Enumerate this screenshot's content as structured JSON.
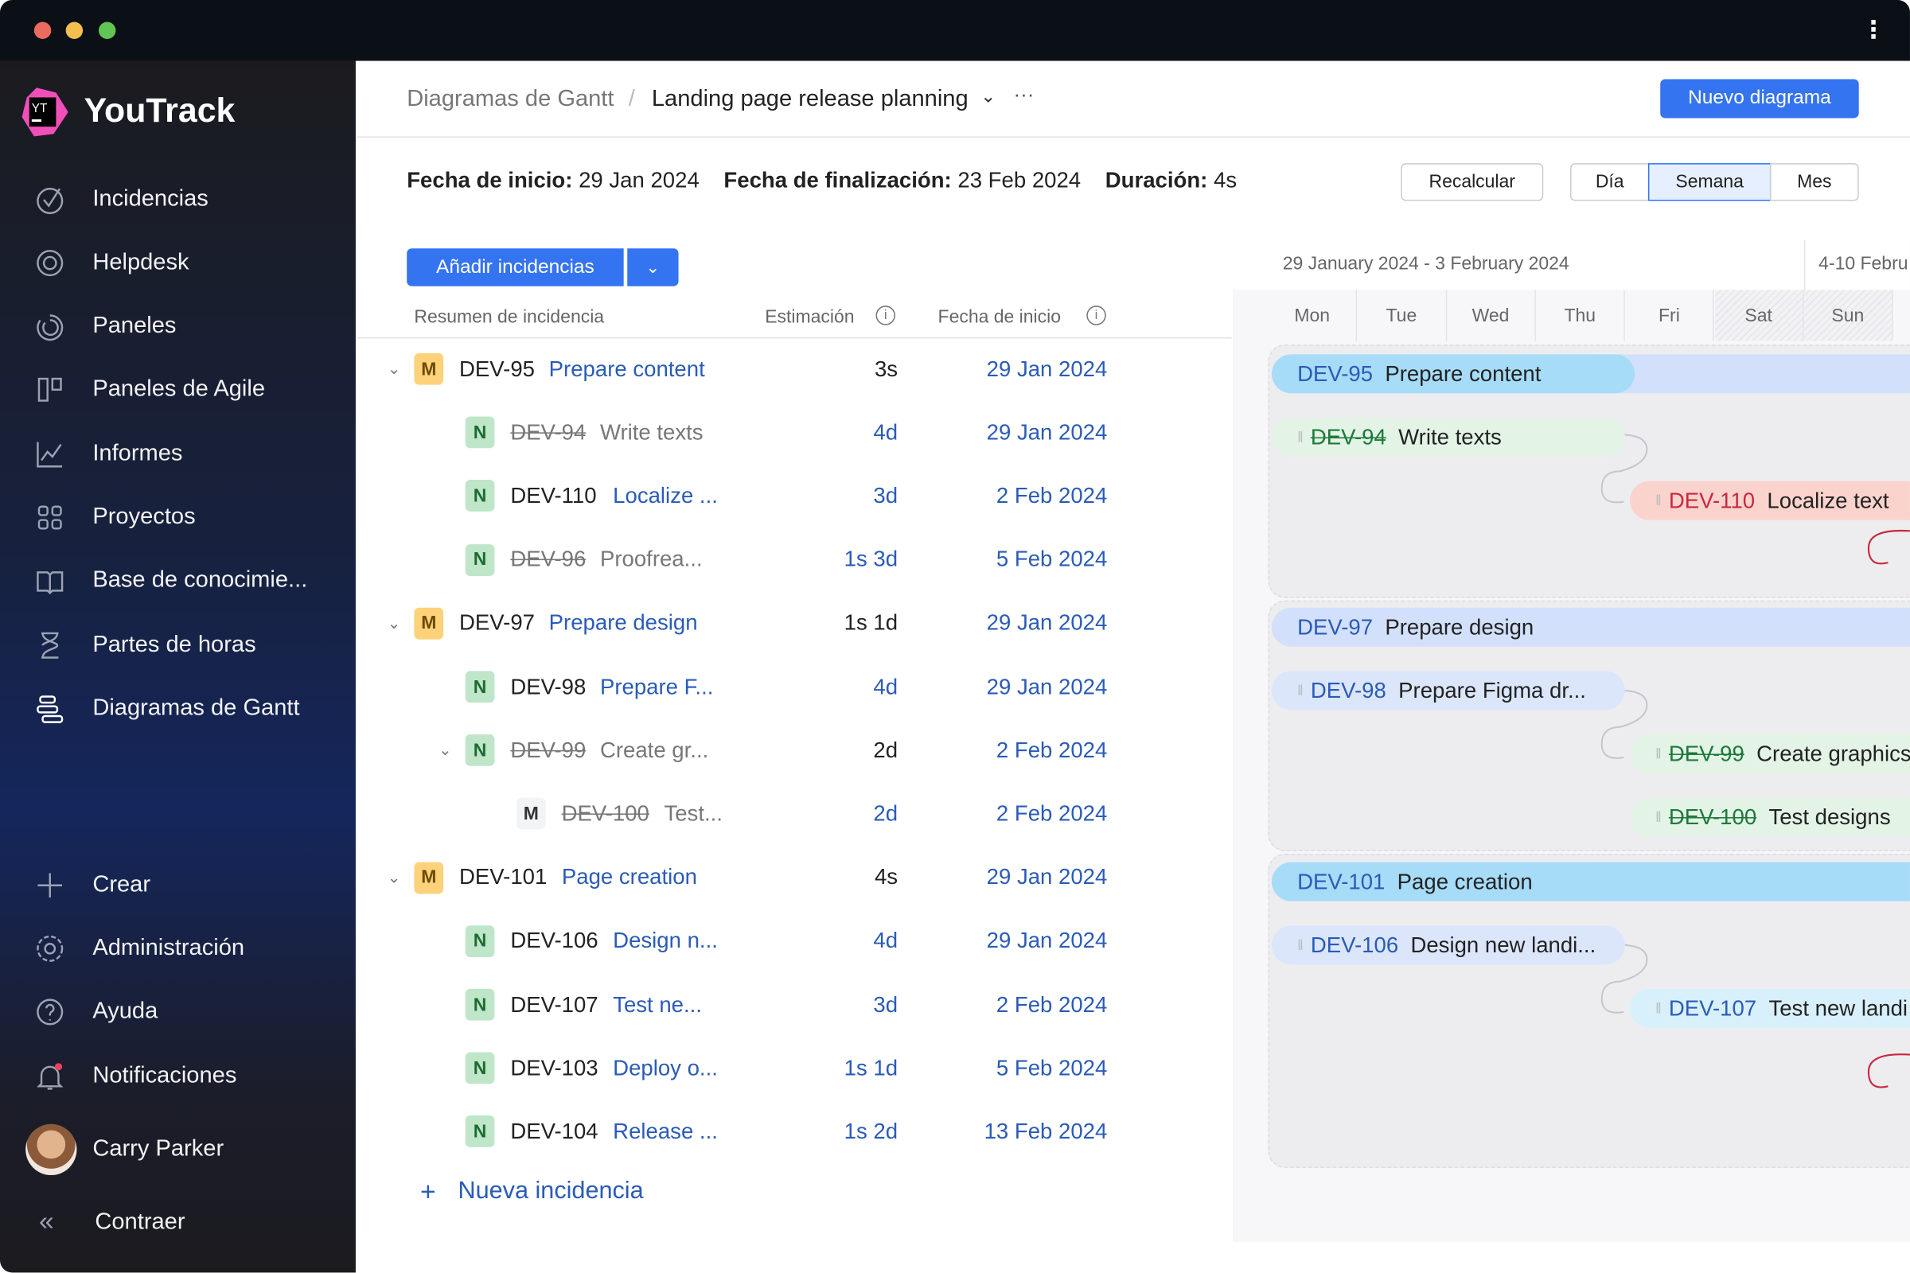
{
  "window": {
    "menu_icon": "vertical-dots-icon"
  },
  "sidebar": {
    "brand": "YouTrack",
    "logo_text": "YT",
    "items": [
      {
        "label": "Incidencias",
        "icon": "check-circle-icon"
      },
      {
        "label": "Helpdesk",
        "icon": "lifebuoy-icon"
      },
      {
        "label": "Paneles",
        "icon": "dashboard-icon"
      },
      {
        "label": "Paneles de Agile",
        "icon": "agile-board-icon"
      },
      {
        "label": "Informes",
        "icon": "chart-icon"
      },
      {
        "label": "Proyectos",
        "icon": "grid-icon"
      },
      {
        "label": "Base de conocimie...",
        "icon": "book-icon"
      },
      {
        "label": "Partes de horas",
        "icon": "hourglass-icon"
      },
      {
        "label": "Diagramas de Gantt",
        "icon": "gantt-icon"
      }
    ],
    "bottom": [
      {
        "label": "Crear",
        "icon": "plus-icon"
      },
      {
        "label": "Administración",
        "icon": "gear-icon"
      },
      {
        "label": "Ayuda",
        "icon": "help-icon"
      },
      {
        "label": "Notificaciones",
        "icon": "bell-icon"
      }
    ],
    "user": "Carry Parker",
    "collapse": "Contraer"
  },
  "header": {
    "breadcrumb_root": "Diagramas de Gantt",
    "separator": "/",
    "title": "Landing page release planning",
    "more": "···",
    "new_button": "Nuevo diagrama"
  },
  "summary": {
    "start_label": "Fecha de inicio:",
    "start": "29 Jan 2024",
    "end_label": "Fecha de finalización:",
    "end": "23 Feb 2024",
    "duration_label": "Duración:",
    "duration": "4s"
  },
  "toolbar": {
    "recalc": "Recalcular",
    "scale": [
      "Día",
      "Semana",
      "Mes"
    ],
    "scale_selected": "Semana",
    "add": "Añadir incidencias"
  },
  "table": {
    "columns": [
      "Resumen de incidencia",
      "Estimación",
      "Fecha de inicio"
    ],
    "rows": [
      {
        "type": "M",
        "id": "DEV-95",
        "summary": "Prepare content",
        "estimate": "3s",
        "start": "29 Jan 2024",
        "done": false,
        "level": 0,
        "expand": true
      },
      {
        "type": "N",
        "id": "DEV-94",
        "summary": "Write texts",
        "estimate": "4d",
        "start": "29 Jan 2024",
        "done": true,
        "level": 1
      },
      {
        "type": "N",
        "id": "DEV-110",
        "summary": "Localize ...",
        "estimate": "3d",
        "start": "2 Feb 2024",
        "done": false,
        "level": 1
      },
      {
        "type": "N",
        "id": "DEV-96",
        "summary": "Proofrea...",
        "estimate": "1s 3d",
        "start": "5 Feb 2024",
        "done": true,
        "level": 1
      },
      {
        "type": "M",
        "id": "DEV-97",
        "summary": "Prepare design",
        "estimate": "1s 1d",
        "start": "29 Jan 2024",
        "done": false,
        "level": 0,
        "expand": true
      },
      {
        "type": "N",
        "id": "DEV-98",
        "summary": "Prepare F...",
        "estimate": "4d",
        "start": "29 Jan 2024",
        "done": false,
        "level": 1
      },
      {
        "type": "N",
        "id": "DEV-99",
        "summary": "Create gr...",
        "estimate": "2d",
        "start": "2 Feb 2024",
        "done": true,
        "level": 1,
        "expand": true
      },
      {
        "type": "M",
        "id": "DEV-100",
        "summary": "Test...",
        "estimate": "2d",
        "start": "2 Feb 2024",
        "done": true,
        "level": 2
      },
      {
        "type": "M",
        "id": "DEV-101",
        "summary": "Page creation",
        "estimate": "4s",
        "start": "29 Jan 2024",
        "done": false,
        "level": 0,
        "expand": true
      },
      {
        "type": "N",
        "id": "DEV-106",
        "summary": "Design n...",
        "estimate": "4d",
        "start": "29 Jan 2024",
        "done": false,
        "level": 1
      },
      {
        "type": "N",
        "id": "DEV-107",
        "summary": "Test ne...",
        "estimate": "3d",
        "start": "2 Feb 2024",
        "done": false,
        "level": 1
      },
      {
        "type": "N",
        "id": "DEV-103",
        "summary": "Deploy o...",
        "estimate": "1s 1d",
        "start": "5 Feb 2024",
        "done": false,
        "level": 1
      },
      {
        "type": "N",
        "id": "DEV-104",
        "summary": "Release ...",
        "estimate": "1s 2d",
        "start": "13 Feb 2024",
        "done": false,
        "level": 1
      }
    ],
    "new_issue": "Nueva incidencia"
  },
  "gantt": {
    "weeks": [
      "29 January 2024 - 3 February 2024",
      "4-10 Febru"
    ],
    "days": [
      "Mon",
      "Tue",
      "Wed",
      "Thu",
      "Fri",
      "Sat",
      "Sun"
    ],
    "bars": [
      {
        "id": "DEV-95",
        "title": "Prepare content"
      },
      {
        "id": "DEV-94",
        "title": "Write texts"
      },
      {
        "id": "DEV-110",
        "title": "Localize text"
      },
      {
        "id": "DEV-97",
        "title": "Prepare design"
      },
      {
        "id": "DEV-98",
        "title": "Prepare Figma dr..."
      },
      {
        "id": "DEV-99",
        "title": "Create graphics"
      },
      {
        "id": "DEV-100",
        "title": "Test designs"
      },
      {
        "id": "DEV-101",
        "title": "Page creation"
      },
      {
        "id": "DEV-106",
        "title": "Design new landi..."
      },
      {
        "id": "DEV-107",
        "title": "Test new landi"
      }
    ]
  },
  "colors": {
    "accent": "#3574f0",
    "link": "#2a5bb8",
    "late": "#c9283e",
    "done": "#1d7a3a"
  }
}
